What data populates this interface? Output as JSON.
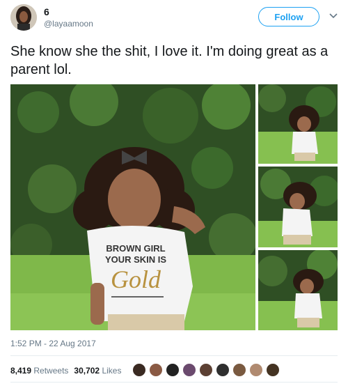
{
  "user": {
    "display_name": "6",
    "handle": "@layaamoon",
    "avatar_icon": "profile-photo"
  },
  "follow_label": "Follow",
  "tweet": {
    "text": "She know she the shit, I love it. I'm doing great as a parent lol.",
    "timestamp": "1:52 PM - 22 Aug 2017"
  },
  "shirt": {
    "line1": "BROWN GIRL",
    "line2": "YOUR SKIN IS",
    "line3": "Gold"
  },
  "stats": {
    "retweets_count": "8,419",
    "retweets_label": "Retweets",
    "likes_count": "30,702",
    "likes_label": "Likes"
  },
  "likers": [
    "#3a2a22",
    "#8a5a44",
    "#222222",
    "#6b4a6e",
    "#5c4033",
    "#2f2f2f",
    "#7a5a40",
    "#b08a70",
    "#443322"
  ],
  "colors": {
    "accent": "#1da1f2",
    "secondary_text": "#657786",
    "grass": "#7fb84a",
    "hedge": "#2f4f24"
  }
}
